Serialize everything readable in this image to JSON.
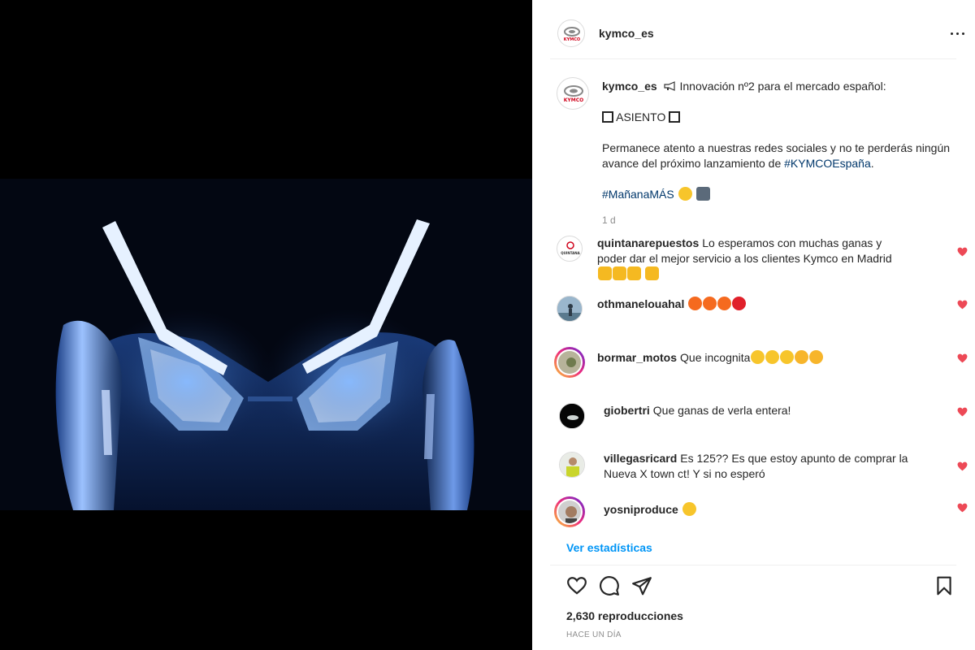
{
  "post": {
    "username": "kymco_es",
    "logo_text": "KYMCO",
    "caption": {
      "intro": "Innovación nº2 para el mercado español:",
      "highlight": "ASIENTO",
      "body_pre": "Permanece atento a nuestras redes sociales y no te perderás ningún avance del próximo lanzamiento de",
      "hashtag1": "#KYMCOEspaña",
      "body_post": ".",
      "hashtag2": "#MañanaMÁS",
      "time": "1 d"
    },
    "more_icon": "more-horizontal-icon"
  },
  "comments": [
    {
      "username": "quintanarepuestos",
      "text": "Lo esperamos con muchas ganas y poder dar el mejor servicio a los clientes Kymco en Madrid",
      "avatar_text": "QUINTANA",
      "emoji": [
        "clap",
        "clap",
        "clap",
        "clap"
      ]
    },
    {
      "username": "othmanelouahal",
      "text": "",
      "emoji": [
        "fire",
        "fire",
        "fire",
        "red-heart"
      ]
    },
    {
      "username": "bormar_motos",
      "text": "Que incognita",
      "emoji": [
        "thinking",
        "thinking",
        "thinking",
        "star-struck",
        "star-struck"
      ]
    },
    {
      "username": "giobertri",
      "text": "Que ganas de verla entera!",
      "emoji": []
    },
    {
      "username": "villegasricard",
      "text": "Es 125?? Es que estoy apunto de comprar la Nueva X town ct! Y si no esperó",
      "emoji": []
    },
    {
      "username": "yosniproduce",
      "text": "",
      "emoji": [
        "hushed"
      ]
    }
  ],
  "footer": {
    "stats_link": "Ver estadísticas",
    "views": "2,630 reproducciones",
    "posted": "HACE UN DÍA"
  },
  "colors": {
    "link": "#0095f6",
    "hashtag": "#00376b",
    "heart": "#ed4956",
    "text": "#262626",
    "muted": "#8e8e8e"
  }
}
